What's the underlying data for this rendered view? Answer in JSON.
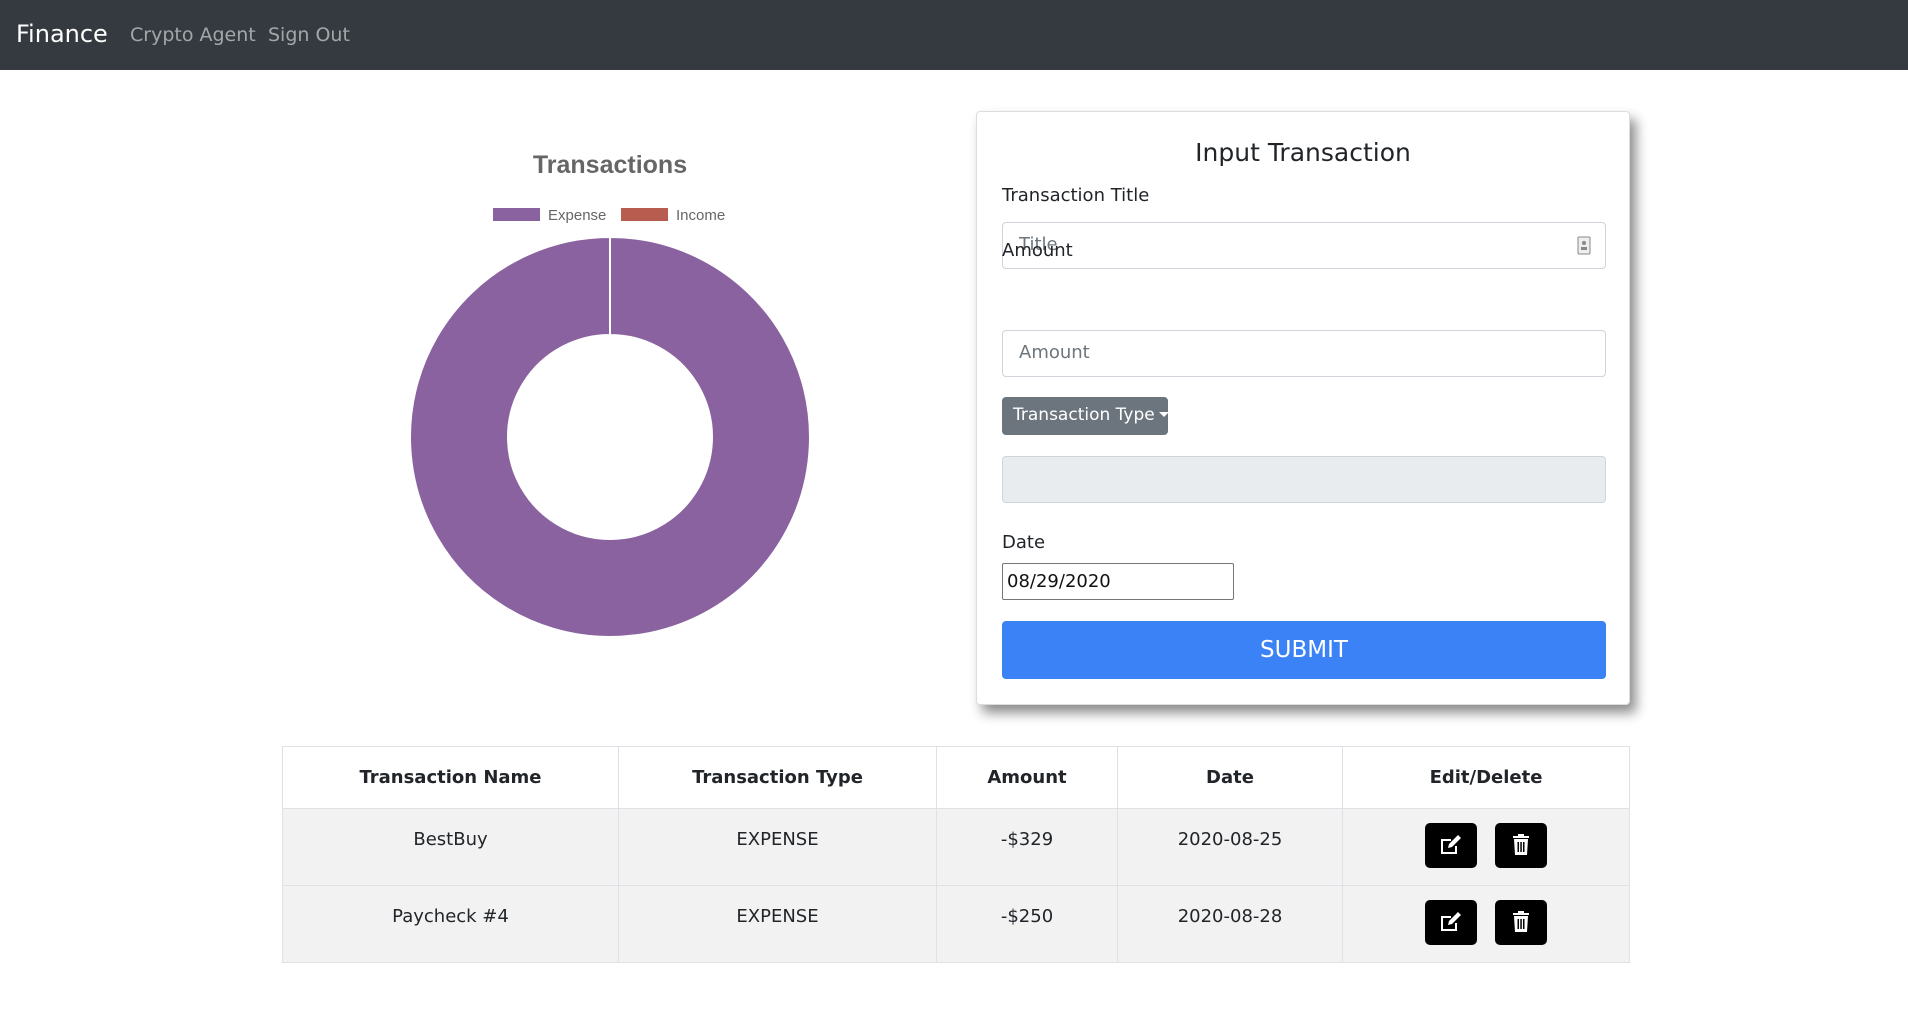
{
  "nav": {
    "brand": "Finance",
    "links": [
      "Crypto Agent",
      "Sign Out"
    ]
  },
  "chart_data": {
    "type": "pie",
    "variant": "doughnut",
    "title": "Transactions",
    "categories": [
      "Expense",
      "Income"
    ],
    "values": [
      579,
      0
    ],
    "colors": [
      "#8a62a0",
      "#b85c50"
    ],
    "legend": "top"
  },
  "form": {
    "title": "Input Transaction",
    "title_label": "Transaction Title",
    "title_placeholder": "Title",
    "amount_label": "Amount",
    "amount_placeholder": "Amount",
    "type_button": "Transaction Type",
    "date_label": "Date",
    "date_value": "08/29/2020",
    "submit": "SUBMIT",
    "colors": {
      "submit": "#3b82f6",
      "dropdown": "#6c757d"
    }
  },
  "table": {
    "headers": [
      "Transaction Name",
      "Transaction Type",
      "Amount",
      "Date",
      "Edit/Delete"
    ],
    "rows": [
      [
        "BestBuy",
        "EXPENSE",
        "-$329",
        "2020-08-25"
      ],
      [
        "Paycheck #4",
        "EXPENSE",
        "-$250",
        "2020-08-28"
      ]
    ]
  },
  "icons": {
    "edit": "edit-icon",
    "delete": "trash-icon",
    "input_helper": "contact-card-icon"
  }
}
